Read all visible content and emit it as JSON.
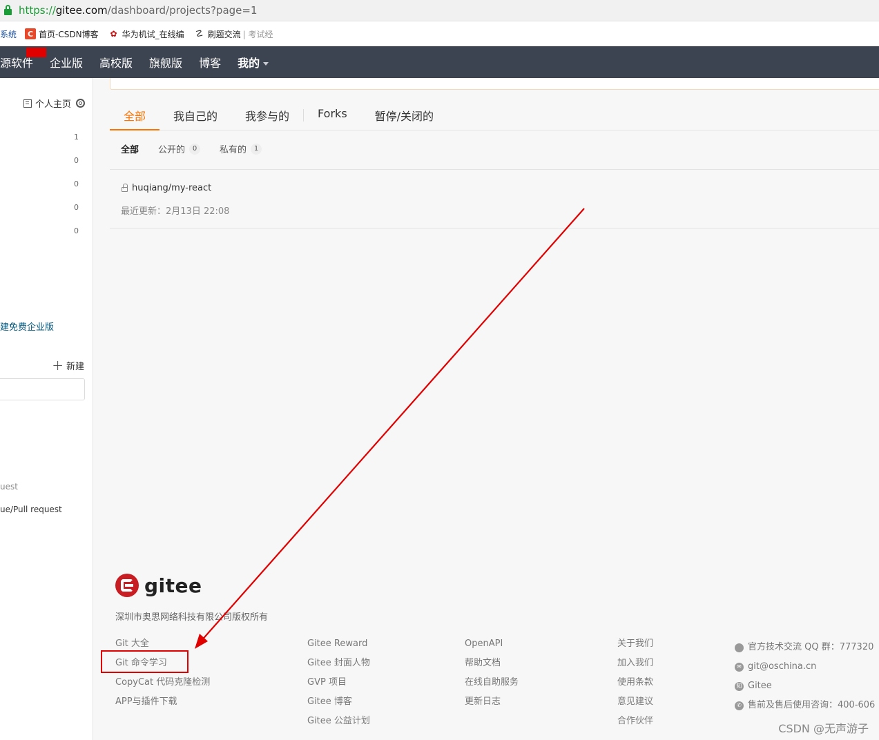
{
  "browser": {
    "url_proto": "https://",
    "url_host": "gitee.com",
    "url_path": "/dashboard/projects?page=1",
    "bookmarks": [
      {
        "label": "系统",
        "icon": ""
      },
      {
        "label": "首页-CSDN博客",
        "icon": "C"
      },
      {
        "label": "华为机试_在线编",
        "icon": "华"
      },
      {
        "label": "刷题交流",
        "extra": "| 考试经",
        "icon": "刷"
      }
    ]
  },
  "nav": {
    "items": [
      "源软件",
      "企业版",
      "高校版",
      "旗舰版",
      "博客",
      "我的"
    ]
  },
  "sidebar": {
    "home_label": "个人主页",
    "counts": [
      "1",
      "0",
      "0",
      "0",
      "0"
    ],
    "trial_link": "建免费企业版",
    "new_label": "新建",
    "text1": "uest",
    "text2": "ue/Pull request"
  },
  "tabs": [
    "全部",
    "我自己的",
    "我参与的",
    "Forks",
    "暂停/关闭的"
  ],
  "filters": [
    {
      "label": "全部",
      "count": ""
    },
    {
      "label": "公开的",
      "count": "0"
    },
    {
      "label": "私有的",
      "count": "1"
    }
  ],
  "repo": {
    "name": "huqiang/my-react",
    "updated": "最近更新：2月13日 22:08"
  },
  "footer": {
    "logo_text": "gitee",
    "copyright": "深圳市奥思网络科技有限公司版权所有",
    "col1": [
      "Git 大全",
      "Git 命令学习",
      "CopyCat 代码克隆检测",
      "APP与插件下载"
    ],
    "col2": [
      "Gitee Reward",
      "Gitee 封面人物",
      "GVP 项目",
      "Gitee 博客",
      "Gitee 公益计划"
    ],
    "col3": [
      "OpenAPI",
      "帮助文档",
      "在线自助服务",
      "更新日志"
    ],
    "col4": [
      "关于我们",
      "加入我们",
      "使用条款",
      "意见建议",
      "合作伙伴"
    ],
    "col5": [
      "官方技术交流 QQ 群：777320",
      "git@oschina.cn",
      "Gitee",
      "售前及售后使用咨询：400-606"
    ]
  },
  "watermark": "CSDN @无声游子",
  "colors": {
    "accent": "#fe7300",
    "nav_bg": "#3d4451",
    "annotation": "#e00000"
  }
}
